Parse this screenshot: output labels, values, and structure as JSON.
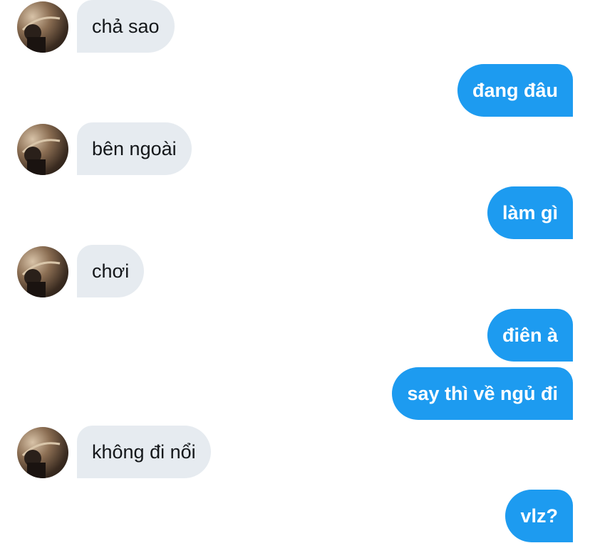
{
  "conversation": {
    "messages": [
      {
        "direction": "received",
        "text": "chả sao"
      },
      {
        "direction": "sent",
        "text": "đang đâu"
      },
      {
        "direction": "received",
        "text": "bên ngoài"
      },
      {
        "direction": "sent",
        "text": "làm gì"
      },
      {
        "direction": "received",
        "text": "chơi"
      },
      {
        "direction": "sent",
        "text": "điên à"
      },
      {
        "direction": "sent",
        "text": "say thì về ngủ đi"
      },
      {
        "direction": "received",
        "text": "không đi nổi"
      },
      {
        "direction": "sent",
        "text": "vlz?"
      }
    ]
  },
  "colors": {
    "sent_bubble": "#1d9bf0",
    "received_bubble": "#e6ebf0",
    "sent_text": "#ffffff",
    "received_text": "#14171a"
  },
  "icons": {
    "avatar": "contact-avatar"
  }
}
